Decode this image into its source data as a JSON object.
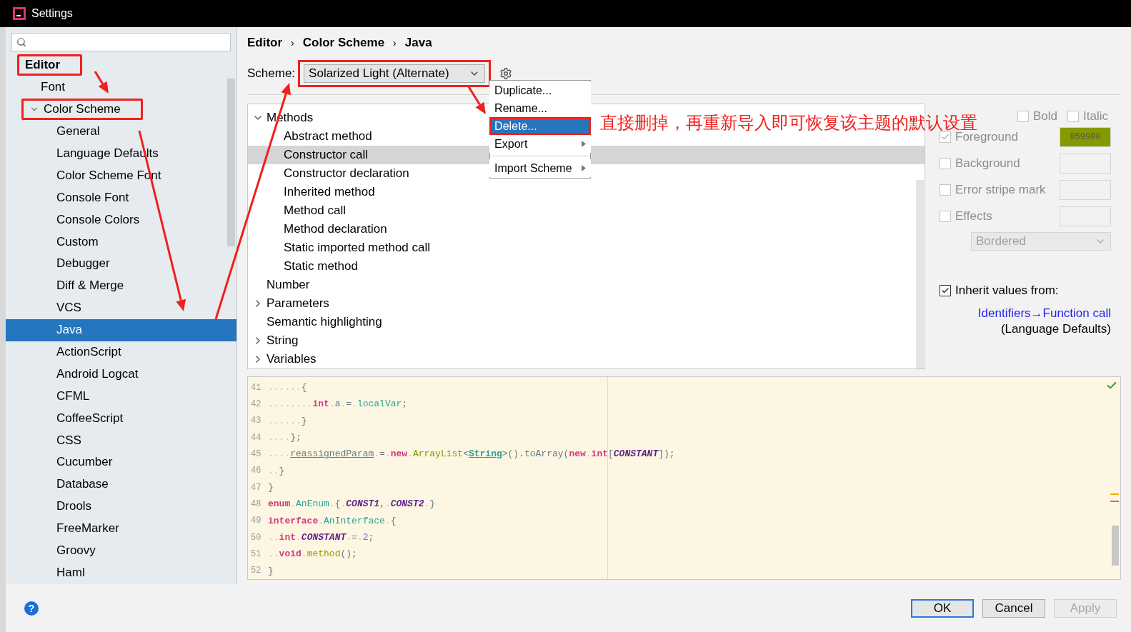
{
  "window": {
    "title": "Settings"
  },
  "sidebar": {
    "items": [
      {
        "label": "Editor",
        "bold": true,
        "annotated": true,
        "selected": false,
        "children": [
          {
            "label": "Font",
            "selected": false,
            "annotated": false
          },
          {
            "label": "Color Scheme",
            "expanded": true,
            "annotated": true,
            "selected": false,
            "children": [
              {
                "label": "General",
                "selected": false
              },
              {
                "label": "Language Defaults",
                "selected": false
              },
              {
                "label": "Color Scheme Font",
                "selected": false
              },
              {
                "label": "Console Font",
                "selected": false
              },
              {
                "label": "Console Colors",
                "selected": false
              },
              {
                "label": "Custom",
                "selected": false
              },
              {
                "label": "Debugger",
                "selected": false
              },
              {
                "label": "Diff & Merge",
                "selected": false
              },
              {
                "label": "VCS",
                "selected": false
              },
              {
                "label": "Java",
                "selected": true
              },
              {
                "label": "ActionScript",
                "selected": false
              },
              {
                "label": "Android Logcat",
                "selected": false
              },
              {
                "label": "CFML",
                "selected": false
              },
              {
                "label": "CoffeeScript",
                "selected": false
              },
              {
                "label": "CSS",
                "selected": false
              },
              {
                "label": "Cucumber",
                "selected": false
              },
              {
                "label": "Database",
                "selected": false
              },
              {
                "label": "Drools",
                "selected": false
              },
              {
                "label": "FreeMarker",
                "selected": false
              },
              {
                "label": "Groovy",
                "selected": false
              },
              {
                "label": "Haml",
                "selected": false
              }
            ]
          }
        ]
      }
    ]
  },
  "breadcrumb": {
    "items": [
      "Editor",
      "Color Scheme",
      "Java"
    ],
    "separator": "›"
  },
  "help": "?",
  "scheme": {
    "label": "Scheme:",
    "value": "Solarized Light (Alternate)",
    "annotated": true
  },
  "gear_menu": [
    {
      "label": "Duplicate...",
      "kind": "item",
      "selected": false,
      "annotated": false
    },
    {
      "label": "Rename...",
      "kind": "item",
      "selected": false,
      "annotated": false
    },
    {
      "label": "Delete...",
      "kind": "item",
      "selected": true,
      "annotated": true
    },
    {
      "label": "Export",
      "kind": "submenu",
      "selected": false,
      "annotated": false
    },
    {
      "label": "Import Scheme",
      "kind": "submenu",
      "selected": false,
      "annotated": false
    }
  ],
  "annotation": {
    "text": "直接删掉，再重新导入即可恢复该主题的默认设置"
  },
  "tree": [
    {
      "label": "Methods",
      "expanded": true,
      "selected": false,
      "children": [
        {
          "label": "Abstract method",
          "selected": false
        },
        {
          "label": "Constructor call",
          "selected": true
        },
        {
          "label": "Constructor declaration",
          "selected": false
        },
        {
          "label": "Inherited method",
          "selected": false
        },
        {
          "label": "Method call",
          "selected": false
        },
        {
          "label": "Method declaration",
          "selected": false
        },
        {
          "label": "Static imported method call",
          "selected": false
        },
        {
          "label": "Static method",
          "selected": false
        }
      ]
    },
    {
      "label": "Number",
      "selected": false
    },
    {
      "label": "Parameters",
      "expanded": false,
      "selected": false
    },
    {
      "label": "Semantic highlighting",
      "selected": false
    },
    {
      "label": "String",
      "expanded": false,
      "selected": false
    },
    {
      "label": "Variables",
      "expanded": false,
      "selected": false
    }
  ],
  "attributes": {
    "bold": {
      "label": "Bold",
      "checked": false
    },
    "italic": {
      "label": "Italic",
      "checked": false
    },
    "rows": [
      {
        "label": "Foreground",
        "checked": true,
        "color": "#859900",
        "value": "859900"
      },
      {
        "label": "Background",
        "checked": false
      },
      {
        "label": "Error stripe mark",
        "checked": false
      },
      {
        "label": "Effects",
        "checked": false
      }
    ],
    "effect_type": "Bordered",
    "inherit": {
      "label": "Inherit values from:",
      "checked": true,
      "link": "Identifiers→Function call",
      "note": "(Language Defaults)"
    }
  },
  "code": [
    {
      "number": "41",
      "tokens": [
        {
          "kind": "ws",
          "text": "......"
        },
        {
          "kind": "plain",
          "text": "{"
        }
      ]
    },
    {
      "number": "42",
      "tokens": [
        {
          "kind": "ws",
          "text": "........"
        },
        {
          "kind": "keyword",
          "text": "int"
        },
        {
          "kind": "ws",
          "text": "."
        },
        {
          "kind": "plain",
          "text": "a"
        },
        {
          "kind": "ws",
          "text": "."
        },
        {
          "kind": "plain",
          "text": "="
        },
        {
          "kind": "ws",
          "text": "."
        },
        {
          "kind": "local",
          "text": "localVar"
        },
        {
          "kind": "plain",
          "text": ";"
        }
      ]
    },
    {
      "number": "43",
      "tokens": [
        {
          "kind": "ws",
          "text": "......"
        },
        {
          "kind": "plain",
          "text": "}"
        }
      ]
    },
    {
      "number": "44",
      "tokens": [
        {
          "kind": "ws",
          "text": "...."
        },
        {
          "kind": "plain",
          "text": "};"
        }
      ]
    },
    {
      "number": "45",
      "tokens": [
        {
          "kind": "ws",
          "text": "...."
        },
        {
          "kind": "param",
          "text": "reassignedParam"
        },
        {
          "kind": "ws",
          "text": "."
        },
        {
          "kind": "plain",
          "text": "="
        },
        {
          "kind": "ws",
          "text": "."
        },
        {
          "kind": "keyword",
          "text": "new"
        },
        {
          "kind": "ws",
          "text": "."
        },
        {
          "kind": "type",
          "text": "ArrayList"
        },
        {
          "kind": "plain",
          "text": "<"
        },
        {
          "kind": "typeref",
          "text": "String"
        },
        {
          "kind": "plain",
          "text": ">().toArray("
        },
        {
          "kind": "keyword",
          "text": "new"
        },
        {
          "kind": "ws",
          "text": "."
        },
        {
          "kind": "keyword",
          "text": "int"
        },
        {
          "kind": "plain",
          "text": "["
        },
        {
          "kind": "constant",
          "text": "CONSTANT"
        },
        {
          "kind": "plain",
          "text": "]);"
        }
      ]
    },
    {
      "number": "46",
      "tokens": [
        {
          "kind": "ws",
          "text": ".."
        },
        {
          "kind": "plain",
          "text": "}"
        }
      ]
    },
    {
      "number": "47",
      "tokens": [
        {
          "kind": "plain",
          "text": "}"
        }
      ]
    },
    {
      "number": "48",
      "tokens": [
        {
          "kind": "keyword",
          "text": "enum"
        },
        {
          "kind": "ws",
          "text": "."
        },
        {
          "kind": "local",
          "text": "AnEnum"
        },
        {
          "kind": "ws",
          "text": "."
        },
        {
          "kind": "plain",
          "text": "{"
        },
        {
          "kind": "ws",
          "text": "."
        },
        {
          "kind": "constant",
          "text": "CONST1"
        },
        {
          "kind": "plain",
          "text": ","
        },
        {
          "kind": "ws",
          "text": "."
        },
        {
          "kind": "constant",
          "text": "CONST2"
        },
        {
          "kind": "ws",
          "text": "."
        },
        {
          "kind": "plain",
          "text": "}"
        }
      ]
    },
    {
      "number": "49",
      "tokens": [
        {
          "kind": "keyword",
          "text": "interface"
        },
        {
          "kind": "ws",
          "text": "."
        },
        {
          "kind": "local",
          "text": "AnInterface"
        },
        {
          "kind": "ws",
          "text": "."
        },
        {
          "kind": "plain",
          "text": "{"
        }
      ]
    },
    {
      "number": "50",
      "tokens": [
        {
          "kind": "ws",
          "text": ".."
        },
        {
          "kind": "keyword",
          "text": "int"
        },
        {
          "kind": "ws",
          "text": "."
        },
        {
          "kind": "constant",
          "text": "CONSTANT"
        },
        {
          "kind": "ws",
          "text": "."
        },
        {
          "kind": "plain",
          "text": "="
        },
        {
          "kind": "ws",
          "text": "."
        },
        {
          "kind": "number",
          "text": "2"
        },
        {
          "kind": "plain",
          "text": ";"
        }
      ]
    },
    {
      "number": "51",
      "tokens": [
        {
          "kind": "ws",
          "text": ".."
        },
        {
          "kind": "keyword",
          "text": "void"
        },
        {
          "kind": "ws",
          "text": "."
        },
        {
          "kind": "method",
          "text": "method"
        },
        {
          "kind": "plain",
          "text": "();"
        }
      ]
    },
    {
      "number": "52",
      "tokens": [
        {
          "kind": "plain",
          "text": "}"
        }
      ]
    }
  ],
  "buttons": [
    {
      "label": "OK",
      "kind": "default",
      "disabled": false
    },
    {
      "label": "Cancel",
      "kind": "normal",
      "disabled": false
    },
    {
      "label": "Apply",
      "kind": "normal",
      "disabled": true
    }
  ]
}
